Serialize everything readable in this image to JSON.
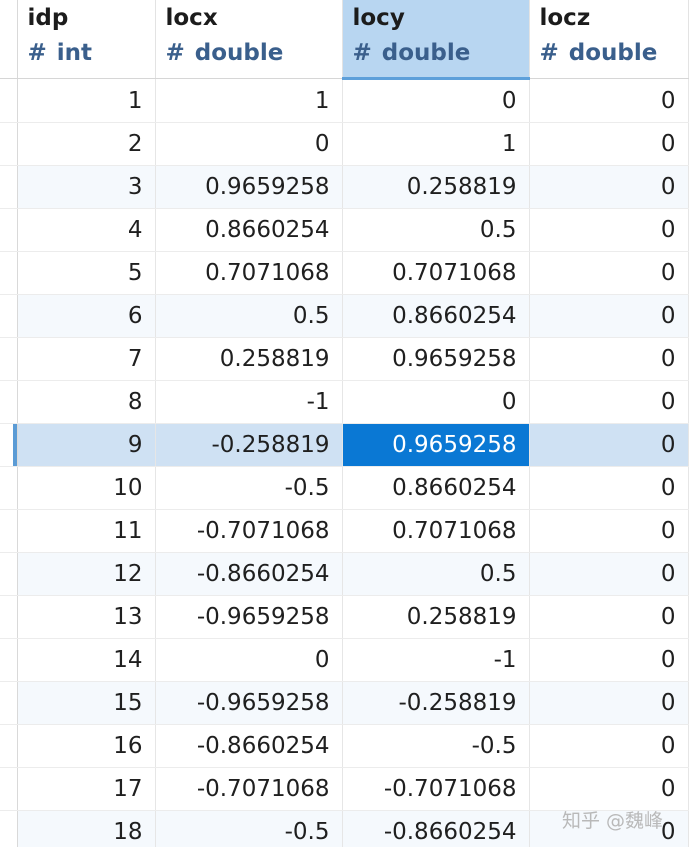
{
  "columns": [
    {
      "name": "idp",
      "type": "int"
    },
    {
      "name": "locx",
      "type": "double"
    },
    {
      "name": "locy",
      "type": "double"
    },
    {
      "name": "locz",
      "type": "double"
    }
  ],
  "type_symbol": "#",
  "selected_column": "locy",
  "selected_row": "9",
  "rows": [
    [
      "1",
      "1",
      "0",
      "0"
    ],
    [
      "2",
      "0",
      "1",
      "0"
    ],
    [
      "3",
      "0.9659258",
      "0.258819",
      "0"
    ],
    [
      "4",
      "0.8660254",
      "0.5",
      "0"
    ],
    [
      "5",
      "0.7071068",
      "0.7071068",
      "0"
    ],
    [
      "6",
      "0.5",
      "0.8660254",
      "0"
    ],
    [
      "7",
      "0.258819",
      "0.9659258",
      "0"
    ],
    [
      "8",
      "-1",
      "0",
      "0"
    ],
    [
      "9",
      "-0.258819",
      "0.9659258",
      "0"
    ],
    [
      "10",
      "-0.5",
      "0.8660254",
      "0"
    ],
    [
      "11",
      "-0.7071068",
      "0.7071068",
      "0"
    ],
    [
      "12",
      "-0.8660254",
      "0.5",
      "0"
    ],
    [
      "13",
      "-0.9659258",
      "0.258819",
      "0"
    ],
    [
      "14",
      "0",
      "-1",
      "0"
    ],
    [
      "15",
      "-0.9659258",
      "-0.258819",
      "0"
    ],
    [
      "16",
      "-0.8660254",
      "-0.5",
      "0"
    ],
    [
      "17",
      "-0.7071068",
      "-0.7071068",
      "0"
    ],
    [
      "18",
      "-0.5",
      "-0.8660254",
      "0"
    ]
  ],
  "watermark": "知乎 @魏峰",
  "colors": {
    "type_text": "#3a5f8c",
    "selected_header": "#b8d6f1",
    "selected_row": "#cfe1f3",
    "active_cell": "#0a78d4"
  }
}
